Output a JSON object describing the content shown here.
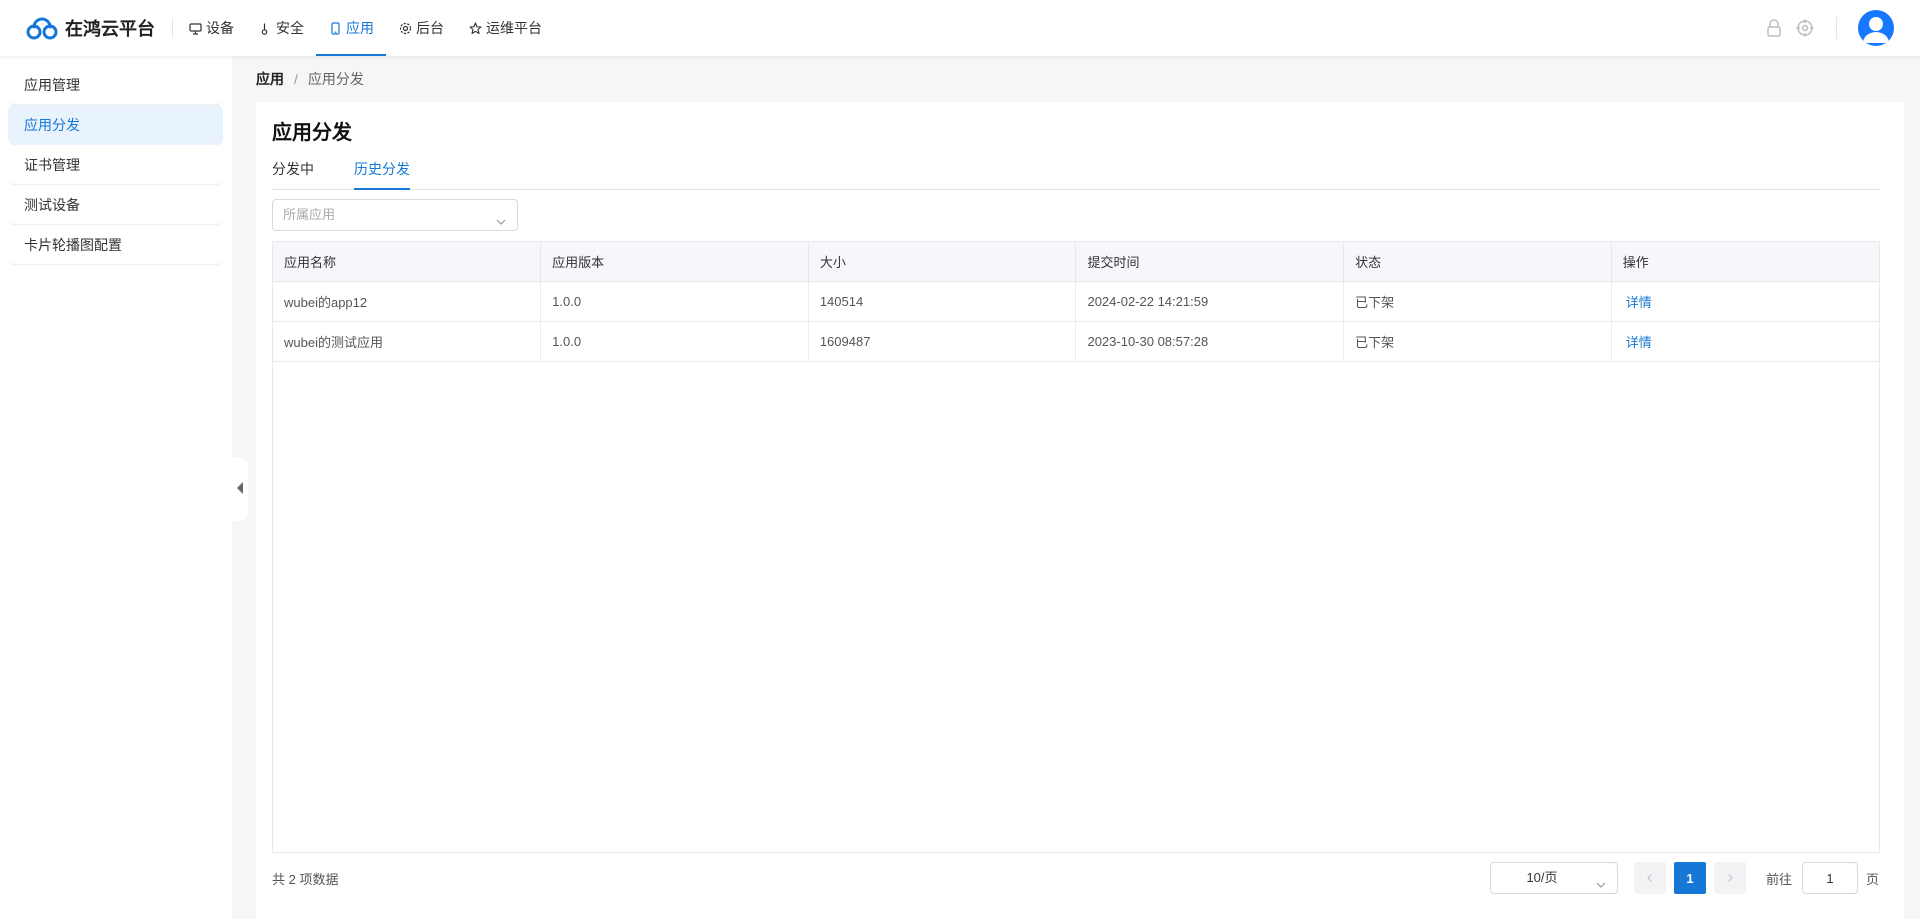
{
  "header": {
    "logo_text": "在鸿云平台",
    "nav": [
      {
        "label": "设备",
        "icon": "monitor-icon"
      },
      {
        "label": "安全",
        "icon": "thermometer-icon"
      },
      {
        "label": "应用",
        "icon": "phone-icon",
        "active": true
      },
      {
        "label": "后台",
        "icon": "gear-icon"
      },
      {
        "label": "运维平台",
        "icon": "star-icon"
      }
    ],
    "accent_color": "#1677d6"
  },
  "sidebar": {
    "items": [
      {
        "label": "应用管理"
      },
      {
        "label": "应用分发",
        "active": true
      },
      {
        "label": "证书管理"
      },
      {
        "label": "测试设备"
      },
      {
        "label": "卡片轮播图配置"
      }
    ]
  },
  "breadcrumb": {
    "root": "应用",
    "separator": "/",
    "current": "应用分发"
  },
  "page": {
    "title": "应用分发",
    "tabs": [
      {
        "label": "分发中"
      },
      {
        "label": "历史分发",
        "active": true
      }
    ],
    "filter_placeholder": "所属应用"
  },
  "table": {
    "columns": [
      "应用名称",
      "应用版本",
      "大小",
      "提交时间",
      "状态",
      "操作"
    ],
    "rows": [
      {
        "name": "wubei的app12",
        "version": "1.0.0",
        "size": "140514",
        "time": "2024-02-22 14:21:59",
        "status": "已下架",
        "action": "详情"
      },
      {
        "name": "wubei的测试应用",
        "version": "1.0.0",
        "size": "1609487",
        "time": "2023-10-30 08:57:28",
        "status": "已下架",
        "action": "详情"
      }
    ]
  },
  "pagination": {
    "total_text": "共 2 项数据",
    "page_size": "10/页",
    "current_page": "1",
    "goto_label": "前往",
    "goto_value": "1",
    "goto_suffix": "页"
  }
}
